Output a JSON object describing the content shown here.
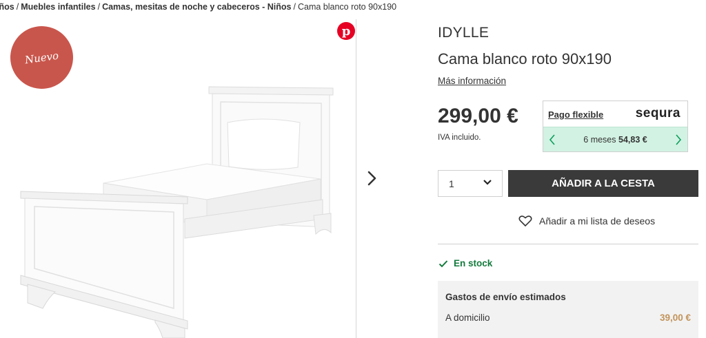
{
  "breadcrumb": {
    "items": [
      "Niños",
      "Muebles infantiles",
      "Camas, mesitas de noche y cabeceros - Niños"
    ],
    "current": "Cama blanco roto 90x190",
    "separator": "/"
  },
  "gallery": {
    "badge": "Nuevo",
    "pinterest_glyph": "p",
    "pinterest_icon": "pinterest-icon",
    "next_icon": "chevron-right-icon"
  },
  "product": {
    "brand": "IDYLLE",
    "name": "Cama blanco roto 90x190",
    "more_info": "Más información",
    "price": "299,00 €",
    "vat": "IVA incluido."
  },
  "sequra": {
    "title": "Pago flexible",
    "logo": "sequra",
    "months": "6 meses",
    "amount": "54,83 €",
    "accent": "#0b9e5b"
  },
  "cart": {
    "quantity": "1",
    "add_button": "AÑADIR A LA CESTA",
    "wishlist": "Añadir a mi lista de deseos"
  },
  "stock": {
    "label": "En stock",
    "color": "#137a3c"
  },
  "shipping": {
    "title": "Gastos de envío estimados",
    "home_label": "A domicilio",
    "home_price": "39,00 €"
  }
}
